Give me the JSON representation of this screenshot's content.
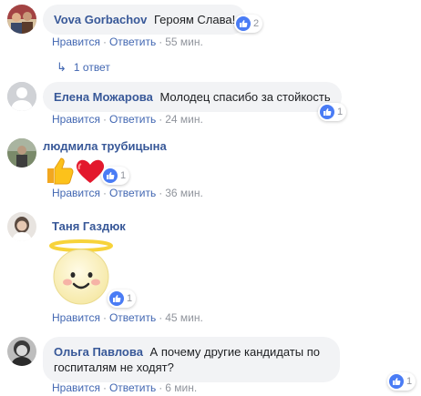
{
  "labels": {
    "like": "Нравится",
    "reply": "Ответить",
    "dot": "·"
  },
  "comments": [
    {
      "author": "Vova Gorbachov",
      "text": "Героям Слава!",
      "time": "55 мин.",
      "reactions": "2",
      "replies": "1 ответ"
    },
    {
      "author": "Елена Можарова",
      "text": "Молодец спасибо за стойкость",
      "time": "24 мин.",
      "reactions": "1"
    },
    {
      "author": "людмила трубицына",
      "text": "",
      "time": "36 мин.",
      "reactions": "1"
    },
    {
      "author": "Таня Газдюк",
      "text": "",
      "time": "45 мин.",
      "reactions": "1"
    },
    {
      "author": "Ольга Павлова",
      "text": "А почему другие кандидаты по госпиталям не ходят?",
      "time": "6 мин.",
      "reactions": "1"
    }
  ],
  "colors": {
    "name": "#385898",
    "link": "#4267b2",
    "bubble": "#f2f3f5",
    "meta": "#90949c",
    "like": "#4a7cf5"
  },
  "icons": [
    "thumbs-up-icon",
    "heart-icon",
    "halo-smiley-sticker",
    "reply-arrow-icon"
  ]
}
